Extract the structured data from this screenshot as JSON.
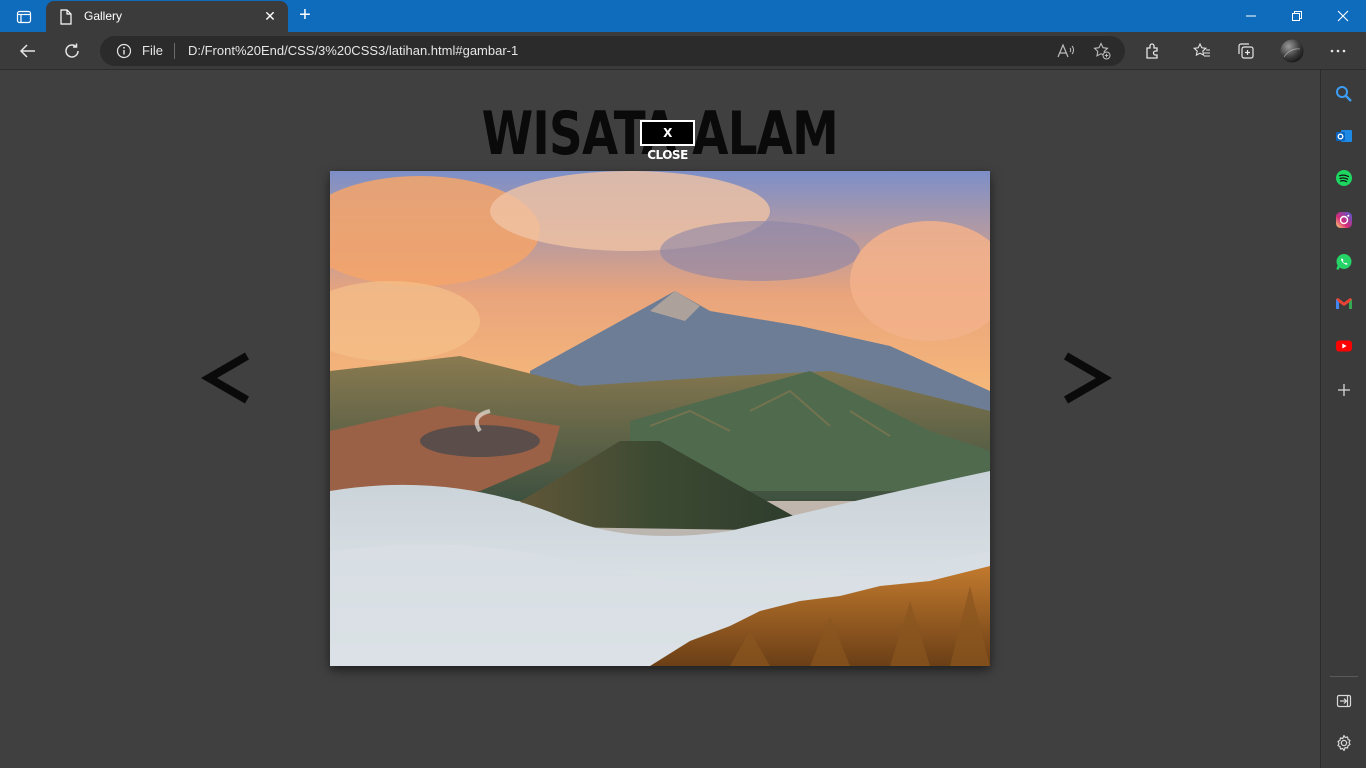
{
  "browser": {
    "tab_title": "Gallery",
    "tab_close": "✕",
    "new_tab": "+",
    "address_scheme": "File",
    "url": "D:/Front%20End/CSS/3%20CSS3/latihan.html#gambar-1",
    "accent_color": "#0f6cbd"
  },
  "page": {
    "heading": "WISATA ALAM",
    "close_label": "X CLOSE",
    "prev_label": "<",
    "next_label": ">",
    "image_subject": "volcano landscape at sunrise"
  },
  "icons": {
    "tab_actions": "tab-actions-icon",
    "page": "page-icon",
    "minimize": "minimize-icon",
    "restore": "restore-icon",
    "close": "close-icon",
    "back": "back-arrow-icon",
    "refresh": "refresh-icon",
    "info": "info-icon",
    "read_aloud": "read-aloud-icon",
    "add_favorite": "add-favorite-icon",
    "extensions": "extensions-icon",
    "favorites": "favorites-icon",
    "collections": "collections-icon",
    "profile": "profile-avatar",
    "more": "more-icon",
    "sidebar": [
      "search-icon",
      "outlook-icon",
      "spotify-icon",
      "instagram-icon",
      "whatsapp-icon",
      "gmail-icon",
      "youtube-icon",
      "add-icon",
      "hide-sidebar-icon",
      "settings-icon"
    ]
  }
}
